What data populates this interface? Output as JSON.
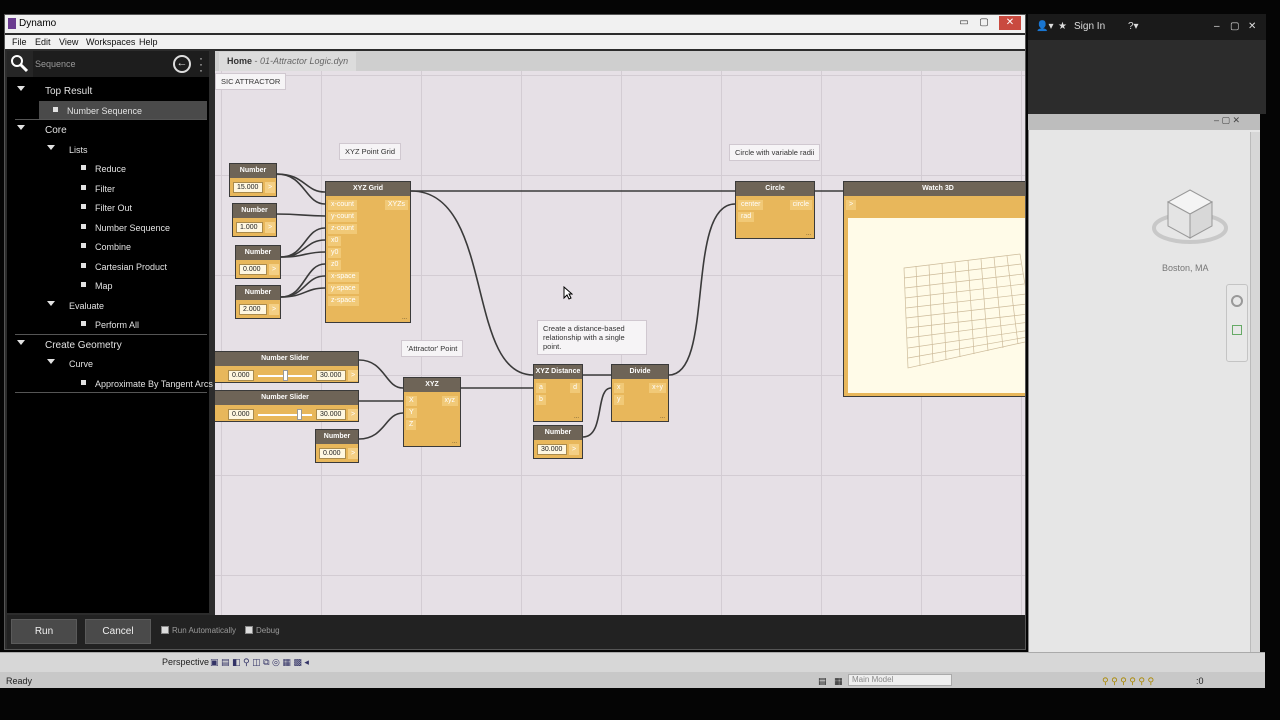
{
  "window": {
    "title": "Dynamo",
    "min": "▭",
    "max": "▢",
    "close": "✕"
  },
  "menu": [
    "File",
    "Edit",
    "View",
    "Workspaces",
    "Help"
  ],
  "library": {
    "search_value": "Sequence",
    "tree": [
      {
        "label": "Top Result",
        "level": 0,
        "kind": "category"
      },
      {
        "label": "Number Sequence",
        "level": 1,
        "kind": "item",
        "selected": true
      },
      {
        "label": "Core",
        "level": 0,
        "kind": "category"
      },
      {
        "label": "Lists",
        "level": 1,
        "kind": "group"
      },
      {
        "label": "Reduce",
        "level": 2,
        "kind": "item"
      },
      {
        "label": "Filter",
        "level": 2,
        "kind": "item"
      },
      {
        "label": "Filter Out",
        "level": 2,
        "kind": "item"
      },
      {
        "label": "Number Sequence",
        "level": 2,
        "kind": "item"
      },
      {
        "label": "Combine",
        "level": 2,
        "kind": "item"
      },
      {
        "label": "Cartesian Product",
        "level": 2,
        "kind": "item"
      },
      {
        "label": "Map",
        "level": 2,
        "kind": "item"
      },
      {
        "label": "Evaluate",
        "level": 1,
        "kind": "group"
      },
      {
        "label": "Perform All",
        "level": 2,
        "kind": "item"
      },
      {
        "label": "Create Geometry",
        "level": 0,
        "kind": "category"
      },
      {
        "label": "Curve",
        "level": 1,
        "kind": "group"
      },
      {
        "label": "Approximate By Tangent Arcs",
        "level": 2,
        "kind": "item"
      }
    ]
  },
  "workspace": {
    "tab_home": "Home",
    "tab_file": "01-Attractor Logic.dyn",
    "note_basic": "SIC ATTRACTOR",
    "note_grid": "XYZ Point Grid",
    "note_circle": "Circle with variable radii",
    "note_attractor": "'Attractor' Point",
    "note_distance": "Create a distance-based relationship with a single point."
  },
  "nodes": {
    "number1": {
      "title": "Number",
      "value": "15.000"
    },
    "number2": {
      "title": "Number",
      "value": "1.000"
    },
    "number3": {
      "title": "Number",
      "value": "0.000"
    },
    "number4": {
      "title": "Number",
      "value": "2.000"
    },
    "xyzgrid": {
      "title": "XYZ Grid",
      "inputs": [
        "x-count",
        "y-count",
        "z-count",
        "x0",
        "y0",
        "z0",
        "x-space",
        "y-space",
        "z-space"
      ],
      "output": "XYZs"
    },
    "slider1": {
      "title": "Number Slider",
      "min": "0.000",
      "max": "30.000"
    },
    "slider2": {
      "title": "Number Slider",
      "min": "0.000",
      "max": "30.000"
    },
    "number5": {
      "title": "Number",
      "value": "0.000"
    },
    "xyz": {
      "title": "XYZ",
      "inputs": [
        "X",
        "Y",
        "Z"
      ],
      "output": "xyz"
    },
    "distance": {
      "title": "XYZ Distance",
      "inputs": [
        "a",
        "b"
      ],
      "output": "d"
    },
    "number6": {
      "title": "Number",
      "value": "30.000"
    },
    "divide": {
      "title": "Divide",
      "inputs": [
        "x",
        "y"
      ],
      "output": "x÷y"
    },
    "circle": {
      "title": "Circle",
      "inputs": [
        "center",
        "rad"
      ],
      "output": "circle"
    },
    "watch3d": {
      "title": "Watch 3D",
      "port": ">"
    },
    "footer": "..."
  },
  "bottom": {
    "run": "Run",
    "cancel": "Cancel",
    "run_auto": "Run Automatically",
    "debug": "Debug"
  },
  "host": {
    "sign_in": "Sign In",
    "city": "Boston, MA",
    "view": "Perspective",
    "status": "Ready",
    "model": "Main Model",
    "zero": ":0"
  }
}
